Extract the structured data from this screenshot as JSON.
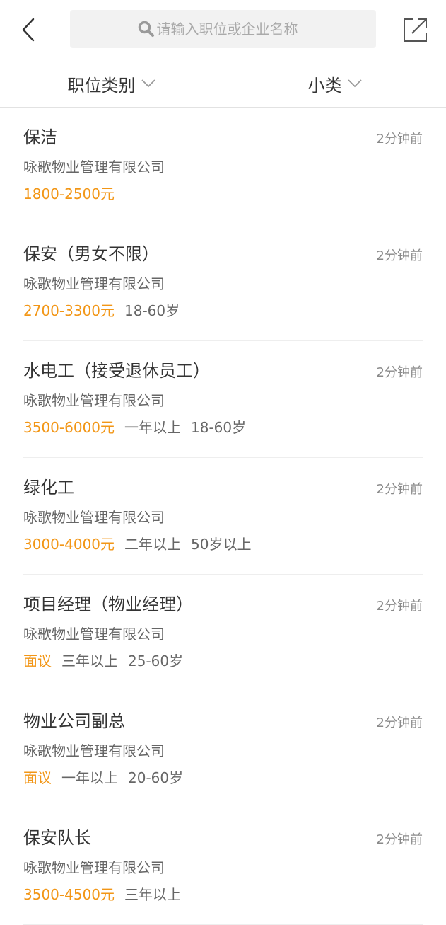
{
  "header": {
    "search_placeholder": "请输入职位或企业名称"
  },
  "filters": {
    "category_label": "职位类别",
    "subcategory_label": "小类"
  },
  "jobs": [
    {
      "title": "保洁",
      "time": "2分钟前",
      "company": "咏歌物业管理有限公司",
      "salary": "1800-2500元",
      "req1": "",
      "req2": ""
    },
    {
      "title": "保安（男女不限）",
      "time": "2分钟前",
      "company": "咏歌物业管理有限公司",
      "salary": "2700-3300元",
      "req1": "18-60岁",
      "req2": ""
    },
    {
      "title": "水电工（接受退休员工）",
      "time": "2分钟前",
      "company": "咏歌物业管理有限公司",
      "salary": "3500-6000元",
      "req1": "一年以上",
      "req2": "18-60岁"
    },
    {
      "title": "绿化工",
      "time": "2分钟前",
      "company": "咏歌物业管理有限公司",
      "salary": "3000-4000元",
      "req1": "二年以上",
      "req2": "50岁以上"
    },
    {
      "title": "项目经理（物业经理）",
      "time": "2分钟前",
      "company": "咏歌物业管理有限公司",
      "salary": "面议",
      "req1": "三年以上",
      "req2": "25-60岁"
    },
    {
      "title": "物业公司副总",
      "time": "2分钟前",
      "company": "咏歌物业管理有限公司",
      "salary": "面议",
      "req1": "一年以上",
      "req2": "20-60岁"
    },
    {
      "title": "保安队长",
      "time": "2分钟前",
      "company": "咏歌物业管理有限公司",
      "salary": "3500-4500元",
      "req1": "三年以上",
      "req2": ""
    }
  ],
  "colors": {
    "salary": "#f29616",
    "icon": "#9a9a9a"
  }
}
